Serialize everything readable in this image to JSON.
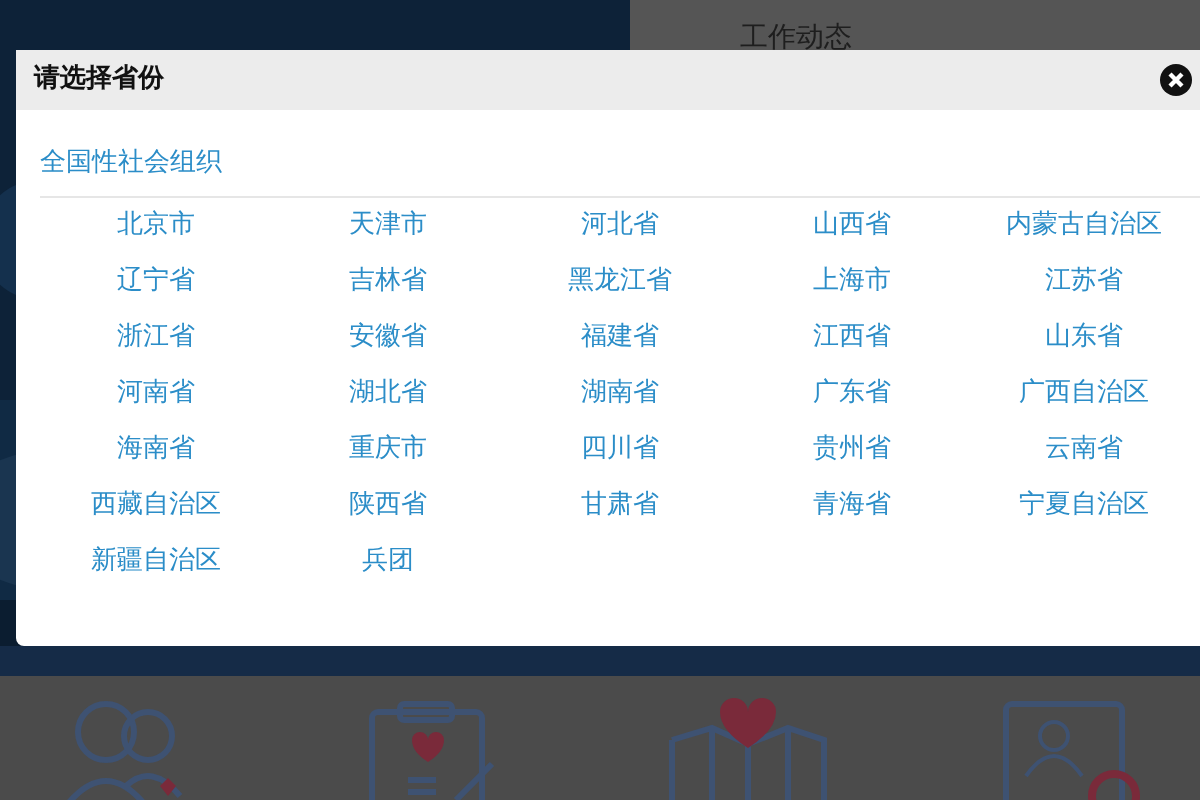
{
  "background": {
    "panel_title": "工作动态"
  },
  "dialog": {
    "title": "请选择省份",
    "national_link": "全国性社会组织",
    "provinces": [
      "北京市",
      "天津市",
      "河北省",
      "山西省",
      "内蒙古自治区",
      "辽宁省",
      "吉林省",
      "黑龙江省",
      "上海市",
      "江苏省",
      "浙江省",
      "安徽省",
      "福建省",
      "江西省",
      "山东省",
      "河南省",
      "湖北省",
      "湖南省",
      "广东省",
      "广西自治区",
      "海南省",
      "重庆市",
      "四川省",
      "贵州省",
      "云南省",
      "西藏自治区",
      "陕西省",
      "甘肃省",
      "青海省",
      "宁夏自治区",
      "新疆自治区",
      "兵团"
    ]
  }
}
